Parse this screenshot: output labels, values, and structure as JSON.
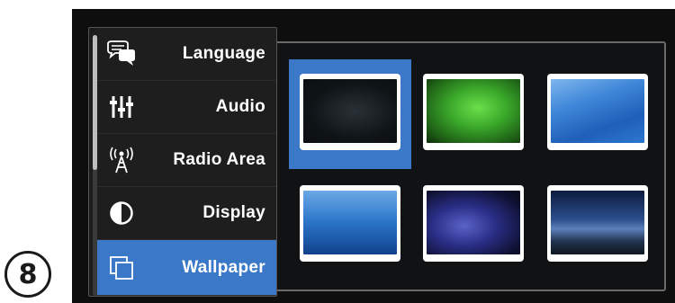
{
  "step_number": "8",
  "menu": {
    "items": [
      {
        "label": "Language",
        "icon": "speech-bubbles-icon",
        "selected": false
      },
      {
        "label": "Audio",
        "icon": "equalizer-sliders-icon",
        "selected": false
      },
      {
        "label": "Radio Area",
        "icon": "radio-tower-icon",
        "selected": false
      },
      {
        "label": "Display",
        "icon": "contrast-circle-icon",
        "selected": false
      },
      {
        "label": "Wallpaper",
        "icon": "overlapping-squares-icon",
        "selected": true
      }
    ]
  },
  "wallpapers": [
    {
      "style": "dark",
      "selected": true
    },
    {
      "style": "green",
      "selected": false
    },
    {
      "style": "blue-wave",
      "selected": false
    },
    {
      "style": "blue-sea",
      "selected": false
    },
    {
      "style": "nebula",
      "selected": false
    },
    {
      "style": "milky-way",
      "selected": false
    }
  ],
  "colors": {
    "accent": "#3b78c8",
    "screen_background": "#0e0e0e",
    "menu_background": "#1e1e1e"
  }
}
